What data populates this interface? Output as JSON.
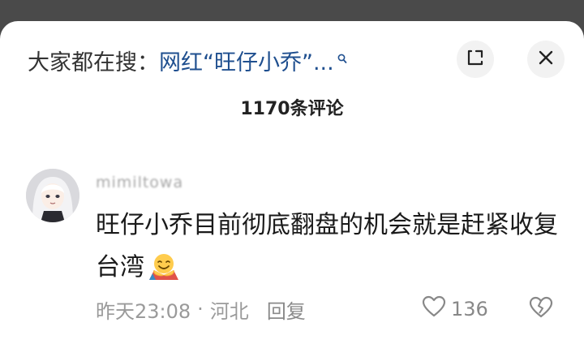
{
  "search": {
    "prefix": "大家都在搜：",
    "term": "网红“旺仔小乔”..."
  },
  "icons": {
    "search": "search-icon",
    "expand": "expand-icon",
    "close": "close-icon",
    "like": "heart-icon",
    "dislike": "broken-heart-icon",
    "emoji": "hugging-face-emoji"
  },
  "comments_header": {
    "count_label": "1170条评论"
  },
  "comment": {
    "username": "mimiltowa",
    "text": "旺仔小乔目前彻底翻盘的机会就是赶紧收复台湾",
    "time": "昨天23:08",
    "separator": "·",
    "location": "河北",
    "reply_label": "回复",
    "like_count": "136"
  },
  "colors": {
    "backdrop": "#4a4a4a",
    "search_term": "#1f4f8f",
    "meta_text": "#9a9a9a"
  }
}
